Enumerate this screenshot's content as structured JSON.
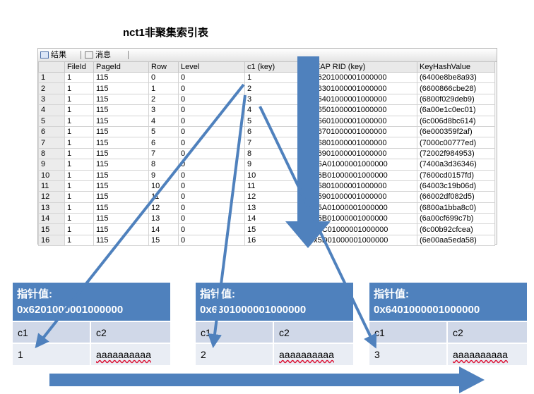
{
  "title": "nct1非聚集索引表",
  "tabs": [
    {
      "label": "结果",
      "icon": "grid-icon"
    },
    {
      "label": "消息",
      "icon": "message-icon"
    }
  ],
  "columns": [
    "",
    "FileId",
    "PageId",
    "Row",
    "Level",
    "c1 (key)",
    "HEAP RID (key)",
    "KeyHashValue"
  ],
  "rows": [
    [
      "1",
      "1",
      "115",
      "0",
      "0",
      "1",
      "0x6201000001000000",
      "(6400e8be8a93)"
    ],
    [
      "2",
      "1",
      "115",
      "1",
      "0",
      "2",
      "0x6301000001000000",
      "(6600866cbe28)"
    ],
    [
      "3",
      "1",
      "115",
      "2",
      "0",
      "3",
      "0x6401000001000000",
      "(6800f029deb9)"
    ],
    [
      "4",
      "1",
      "115",
      "3",
      "0",
      "4",
      "0x6501000001000000",
      "(6a00e1c0ec01)"
    ],
    [
      "5",
      "1",
      "115",
      "4",
      "0",
      "5",
      "0x6601000001000000",
      "(6c006d8bc614)"
    ],
    [
      "6",
      "1",
      "115",
      "5",
      "0",
      "6",
      "0x6701000001000000",
      "(6e000359f2af)"
    ],
    [
      "7",
      "1",
      "115",
      "6",
      "0",
      "7",
      "0x6801000001000000",
      "(7000c00777ed)"
    ],
    [
      "8",
      "1",
      "115",
      "7",
      "0",
      "8",
      "0x6901000001000000",
      "(72002f984953)"
    ],
    [
      "9",
      "1",
      "115",
      "8",
      "0",
      "9",
      "0x6A01000001000000",
      "(7400a3d36346)"
    ],
    [
      "10",
      "1",
      "115",
      "9",
      "0",
      "10",
      "0x6B01000001000000",
      "(7600cd0157fd)"
    ],
    [
      "11",
      "1",
      "115",
      "10",
      "0",
      "11",
      "0x5801000001000000",
      "(64003c19b06d)"
    ],
    [
      "12",
      "1",
      "115",
      "11",
      "0",
      "12",
      "0x5901000001000000",
      "(66002df082d5)"
    ],
    [
      "13",
      "1",
      "115",
      "12",
      "0",
      "13",
      "0x5A01000001000000",
      "(6800a1bba8c0)"
    ],
    [
      "14",
      "1",
      "115",
      "13",
      "0",
      "14",
      "0x5B01000001000000",
      "(6a00cf699c7b)"
    ],
    [
      "15",
      "1",
      "115",
      "14",
      "0",
      "15",
      "0x5C01000001000000",
      "(6c00b92cfcea)"
    ],
    [
      "16",
      "1",
      "115",
      "15",
      "0",
      "16",
      "0x5D01000001000000",
      "(6e00aa5eda58)"
    ]
  ],
  "nodes": [
    {
      "label": "指针值:",
      "pointer": "0x6201000001000000",
      "c1_header": "c1",
      "c2_header": "c2",
      "c1": "1",
      "c2": "aaaaaaaaaa"
    },
    {
      "label": "指针值:",
      "pointer": "0x6301000001000000",
      "c1_header": "c1",
      "c2_header": "c2",
      "c1": "2",
      "c2": "aaaaaaaaaa"
    },
    {
      "label": "指针值:",
      "pointer": "0x6401000001000000",
      "c1_header": "c1",
      "c2_header": "c2",
      "c1": "3",
      "c2": "aaaaaaaaaa"
    }
  ],
  "colors": {
    "arrow": "#4f81bd",
    "node_header": "#4f81bd",
    "node_row1": "#d0d8e8",
    "node_row2": "#e9edf4"
  }
}
